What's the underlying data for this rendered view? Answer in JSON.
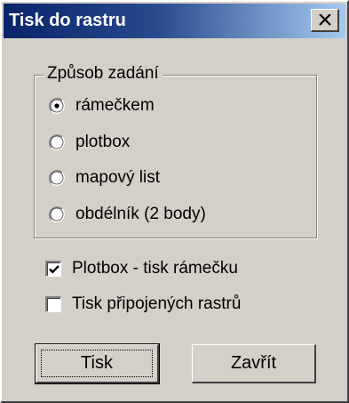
{
  "window": {
    "title": "Tisk do rastru"
  },
  "group": {
    "legend": "Způsob zadání",
    "options": [
      {
        "label": "rámečkem",
        "selected": true
      },
      {
        "label": "plotbox",
        "selected": false
      },
      {
        "label": "mapový list",
        "selected": false
      },
      {
        "label": "obdélník (2 body)",
        "selected": false
      }
    ]
  },
  "checkboxes": [
    {
      "label": "Plotbox - tisk rámečku",
      "checked": true
    },
    {
      "label": "Tisk připojených rastrů",
      "checked": false
    }
  ],
  "buttons": {
    "print_label": "Tisk",
    "close_label": "Zavřít"
  },
  "icons": {
    "close": "close-icon",
    "radio": "radio-button",
    "checkbox": "checkbox-check-icon"
  },
  "colors": {
    "titlebar_start": "#0a246a",
    "titlebar_end": "#a6caf0",
    "face": "#d4d0c8"
  }
}
